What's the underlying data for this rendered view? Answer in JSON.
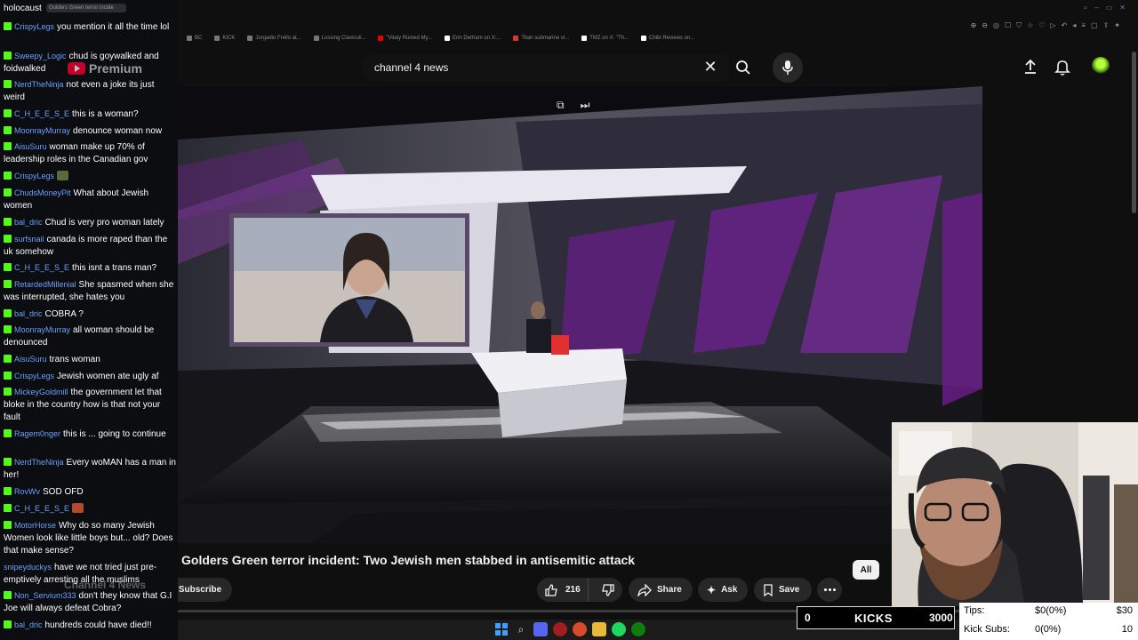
{
  "browser": {
    "bookmarks": [
      "BC",
      "KICK",
      "Jorgadio Frello at...",
      "Lossing Claviculi...",
      "\"Vitaly Ruined My...",
      "Erin Derham on X:...",
      "Titan submarine vi...",
      "TMZ on X: \"Th...",
      "Chibi Reviews on..."
    ]
  },
  "chat": {
    "pinned_tab": "Golders Green terror incide",
    "messages": [
      {
        "user": "",
        "text": "holocaust"
      },
      {
        "user": "CrispyLegs",
        "text": "you mention it all the time lol"
      },
      {
        "user": "Sweepy_Logic",
        "text": "chud is goywalked and foidwalked"
      },
      {
        "user": "NerdTheNinja",
        "text": "not even a joke its just weird"
      },
      {
        "user": "C_H_E_E_S_E",
        "text": "this is a woman?"
      },
      {
        "user": "MoonrayMurray",
        "text": "denounce woman now"
      },
      {
        "user": "AisuSuru",
        "text": "woman make up 70% of leadership roles in the Canadian gov"
      },
      {
        "user": "CrispyLegs",
        "text": ""
      },
      {
        "user": "ChudsMoneyPit",
        "text": "What about Jewish women"
      },
      {
        "user": "bal_dric",
        "text": "Chud is very pro woman lately"
      },
      {
        "user": "surfsnail",
        "text": "canada is more raped than the uk somehow"
      },
      {
        "user": "C_H_E_E_S_E",
        "text": "this isnt a trans man?"
      },
      {
        "user": "RetardedMillenial",
        "text": "She spasmed when she was interrupted, she hates you"
      },
      {
        "user": "bal_dric",
        "text": "COBRA ?"
      },
      {
        "user": "MoonrayMurray",
        "text": "all woman should be denounced"
      },
      {
        "user": "AisuSuru",
        "text": "trans woman"
      },
      {
        "user": "CrispyLegs",
        "text": "Jewish women ate ugly af"
      },
      {
        "user": "MickeyGoldmill",
        "text": "the government let that bloke in the country how is that not your fault"
      },
      {
        "user": "Ragem0nger",
        "text": "this is ... going to continue"
      },
      {
        "user": "NerdTheNinja",
        "text": "Every woMAN has a man in her!"
      },
      {
        "user": "RovWv",
        "text": "SOD OFD"
      },
      {
        "user": "C_H_E_E_S_E",
        "text": ""
      },
      {
        "user": "MotorHorse",
        "text": "Why do so many Jewish Women look like little boys but... old? Does that make sense?"
      },
      {
        "user": "snipeyduckys",
        "text": "have we not tried just pre-emptively arresting all the muslims"
      },
      {
        "user": "Non_Servium333",
        "text": "don't they know that G.I Joe will always defeat Cobra?"
      },
      {
        "user": "bal_dric",
        "text": "hundreds could have died!!"
      }
    ]
  },
  "youtube": {
    "premium_label": "Premium",
    "search_query": "channel 4 news",
    "video_title": "Golders Green terror incident: Two Jewish men stabbed in antisemitic attack",
    "channel": "Channel 4 News",
    "subscribe_label": "Subscribe",
    "like_count": "216",
    "share_label": "Share",
    "ask_label": "Ask",
    "save_label": "Save",
    "filter_chip": "All",
    "progress": 0.0
  },
  "stream": {
    "kicks_count": "0",
    "kicks_label": "KICKS",
    "kicks_goal": "3000",
    "tips_label": "Tips:",
    "tips_value": "$0(0%)",
    "tips_goal": "$30",
    "subs_label": "Kick Subs:",
    "subs_value": "0(0%)",
    "subs_goal": "10"
  },
  "colors": {
    "kick_green": "#53fc18",
    "chat_user": "#6ba0ff",
    "studio_purple": "#7a1fa0"
  }
}
